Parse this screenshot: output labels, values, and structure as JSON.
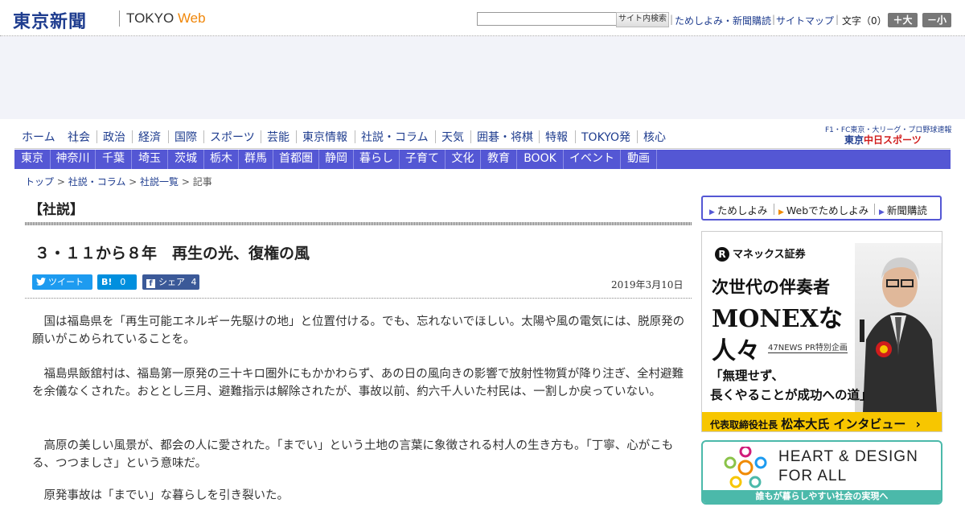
{
  "header": {
    "logo_jp": "東京新聞",
    "logo_en_1": "TOKYO",
    "logo_en_2": "Web",
    "search_button": "サイト内検索",
    "util_links": [
      "ためしよみ・新聞購読",
      "サイトマップ"
    ],
    "font_size_label": "文字（0）",
    "font_larger": "＋大",
    "font_smaller": "－小"
  },
  "nav_main": [
    "ホーム",
    "社会",
    "政治",
    "経済",
    "国際",
    "スポーツ",
    "芸能",
    "東京情報",
    "社説・コラム",
    "天気",
    "囲碁・将棋",
    "特報",
    "TOKYO発",
    "核心"
  ],
  "chunichi": {
    "top_line": "F1・FC東京・大リーグ・プロ野球速報",
    "logo_1": "東京",
    "logo_2": "中日スポーツ"
  },
  "nav_region": [
    "東京",
    "神奈川",
    "千葉",
    "埼玉",
    "茨城",
    "栃木",
    "群馬",
    "首都圏",
    "静岡",
    "暮らし",
    "子育て",
    "文化",
    "教育",
    "BOOK",
    "イベント",
    "動画"
  ],
  "breadcrumb": {
    "items": [
      "トップ",
      "社説・コラム",
      "社説一覧"
    ],
    "current": "記事",
    "separator": " > "
  },
  "article": {
    "section": "【社説】",
    "headline": "３・１１から８年　再生の光、復権の風",
    "date": "2019年3月10日",
    "share": {
      "tweet": "ツイート",
      "hatena_icon": "B!",
      "hatena_count": "0",
      "facebook": "シェア",
      "facebook_count": "4"
    },
    "paragraphs": [
      "国は福島県を「再生可能エネルギー先駆けの地」と位置付ける。でも、忘れないでほしい。太陽や風の電気には、脱原発の願いがこめられていることを。",
      "福島県飯舘村は、福島第一原発の三十キロ圏外にもかかわらず、あの日の風向きの影響で放射性物質が降り注ぎ、全村避難を余儀なくされた。おととし三月、避難指示は解除されたが、事故以前、約六千人いた村民は、一割しか戻っていない。",
      "高原の美しい風景が、都会の人に愛された。「までい」という土地の言葉に象徴される村人の生き方も。「丁寧、心がこもる、つつましさ」という意味だ。",
      "原発事故は「までい」な暮らしを引き裂いた。"
    ]
  },
  "sidebar": {
    "subscribe_links": [
      "ためしよみ",
      "Webでためしよみ",
      "新聞購読"
    ],
    "monex_ad": {
      "logo": "マネックス証券",
      "logo_mark": "R",
      "line1": "次世代の伴奏者",
      "line2": "MONEXな",
      "line3": "人々",
      "tag": "47NEWS PR特別企画",
      "quote1": "「無理せず、",
      "quote2": "長くやることが成功への道」",
      "bar_small": "代表取締役社長",
      "bar_big": "松本大氏 インタビュー",
      "bar_arrow": "›"
    },
    "heart_ad": {
      "line1": "HEART & DESIGN",
      "line2": "FOR ALL",
      "bar": "誰もが暮らしやすい社会の実現へ"
    }
  },
  "colors": {
    "brand_blue": "#1f3d8f",
    "nav_purple": "#5457d4",
    "orange": "#f0870a",
    "teal": "#4bb9aa",
    "monex_yellow": "#f7c600"
  }
}
